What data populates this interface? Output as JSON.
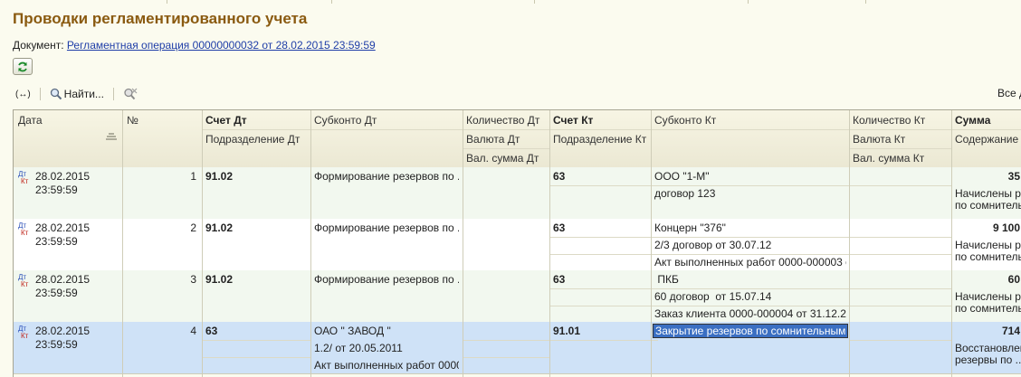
{
  "page": {
    "title": "Проводки регламентированного учета"
  },
  "document": {
    "label": "Документ:",
    "link": "Регламентная операция 00000000032 от 28.02.2015 23:59:59"
  },
  "toolbar": {
    "toggle_label": "(↔)",
    "find_label": "Найти...",
    "all_actions_label": "Все д"
  },
  "colors": {
    "title": "#8a5a10",
    "link": "#1f3ea8",
    "row_alt": "#f2f8ef",
    "row_selected": "#cfe2f7",
    "cell_selected": "#3b6fc2"
  },
  "icons": [
    "refresh-icon",
    "toggle-icon",
    "search-icon",
    "filter-clear-icon",
    "sort-icon",
    "dt-kt-icon"
  ],
  "table": {
    "headers": {
      "date": "Дата",
      "num": "№",
      "acc_dt": "Счет Дт",
      "sub_dt": "Подразделение Дт",
      "subconto_dt": "Субконто Дт",
      "qty_dt": "Количество Дт",
      "cur_dt": "Валюта Дт",
      "cursum_dt": "Вал. сумма Дт",
      "acc_kt": "Счет Кт",
      "sub_kt": "Подразделение Кт",
      "subconto_kt": "Субконто Кт",
      "qty_kt": "Количество Кт",
      "cur_kt": "Валюта Кт",
      "cursum_kt": "Вал. сумма Кт",
      "sum": "Сумма",
      "content": "Содержание"
    },
    "rows": [
      {
        "date": "28.02.2015",
        "time": "23:59:59",
        "num": "1",
        "acc_dt": "91.02",
        "sub_dt": [
          "Формирование резервов по ...",
          "",
          ""
        ],
        "acc_kt": "63",
        "sub_kt": [
          "ООО \"1-М\"",
          "договор 123",
          ""
        ],
        "sum": "35",
        "content": [
          "Начислены ре",
          "по сомнитель"
        ]
      },
      {
        "date": "28.02.2015",
        "time": "23:59:59",
        "num": "2",
        "acc_dt": "91.02",
        "sub_dt": [
          "Формирование резервов по ...",
          "",
          ""
        ],
        "acc_kt": "63",
        "sub_kt": [
          "Концерн \"376\"",
          "2/3 договор от 30.07.12",
          "Акт выполненных работ 0000-000003 о..."
        ],
        "sum": "9 100",
        "content": [
          "Начислены ре",
          "по сомнитель"
        ]
      },
      {
        "date": "28.02.2015",
        "time": "23:59:59",
        "num": "3",
        "acc_dt": "91.02",
        "sub_dt": [
          "Формирование резервов по ...",
          "",
          ""
        ],
        "acc_kt": "63",
        "sub_kt": [
          " ПКБ",
          "60 договор  от 15.07.14",
          "Заказ клиента 0000-000004 от 31.12.20..."
        ],
        "sum": "60",
        "content": [
          "Начислены ре",
          "по сомнитель"
        ]
      },
      {
        "date": "28.02.2015",
        "time": "23:59:59",
        "num": "4",
        "acc_dt": "63",
        "sub_dt": [
          "ОАО \" ЗАВОД \"",
          "1.2/ от 20.05.2011",
          "Акт выполненных работ 0000..."
        ],
        "acc_kt": "91.01",
        "sub_kt": [
          "Закрытие резервов по сомнительным ...",
          "",
          ""
        ],
        "sum": "714",
        "content": [
          "Восстановлен",
          "резервы по ..."
        ]
      }
    ]
  }
}
